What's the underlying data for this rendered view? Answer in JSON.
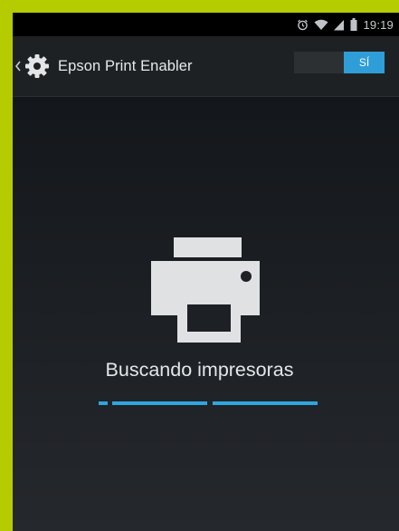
{
  "status_bar": {
    "time": "19:19",
    "icons": [
      "alarm-icon",
      "wifi-icon",
      "signal-icon",
      "battery-icon"
    ]
  },
  "action_bar": {
    "title": "Epson Print Enabler",
    "toggle_label": "SÍ",
    "toggle_state": "on"
  },
  "content": {
    "icon": "printer-icon",
    "message": "Buscando impresoras"
  },
  "colors": {
    "frame": "#b5cc00",
    "accent": "#2fa6de"
  }
}
